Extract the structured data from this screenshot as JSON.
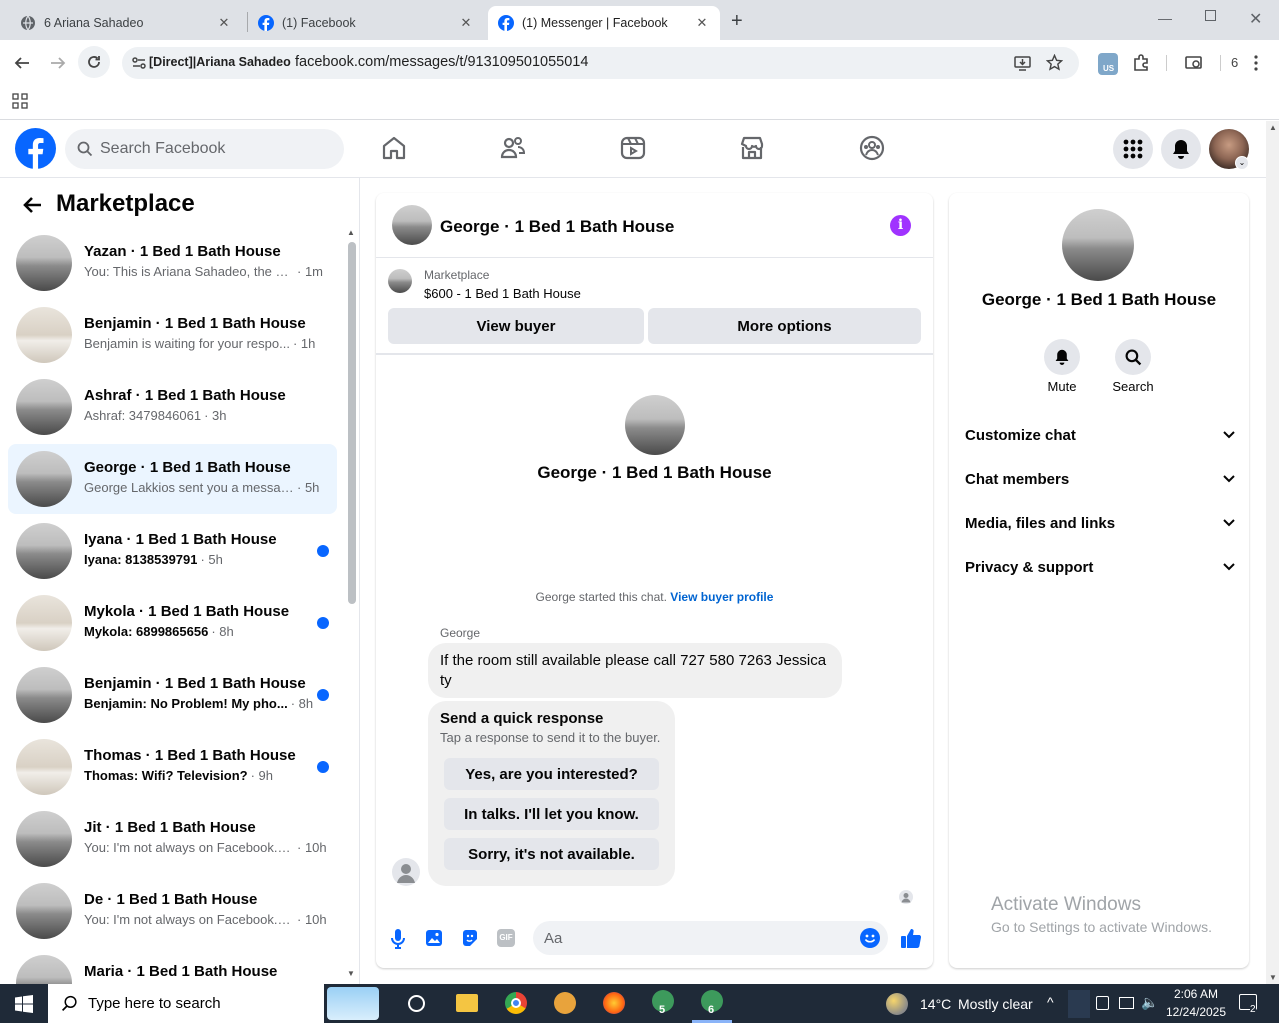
{
  "browser": {
    "tabs": [
      {
        "title": "6 Ariana Sahadeo"
      },
      {
        "title": "(1) Facebook"
      },
      {
        "title": "(1) Messenger | Facebook"
      }
    ],
    "site_chip": "[Direct]|Ariana Sahadeo",
    "url": "facebook.com/messages/t/913109501055014",
    "profile_count": "6"
  },
  "header": {
    "search_placeholder": "Search Facebook"
  },
  "sidebar": {
    "title": "Marketplace",
    "conversations": [
      {
        "name": "Yazan · 1 Bed 1 Bath House",
        "preview": "You: This is Ariana Sahadeo, the pr...",
        "time": "· 1m",
        "unread": false,
        "avatar": "house"
      },
      {
        "name": "Benjamin · 1 Bed 1 Bath House",
        "preview": "Benjamin is waiting for your respo...",
        "time": "· 1h",
        "unread": false,
        "avatar": "light"
      },
      {
        "name": "Ashraf · 1 Bed 1 Bath House",
        "preview": "Ashraf: 3479846061",
        "time": "· 3h",
        "unread": false,
        "avatar": "house"
      },
      {
        "name": "George · 1 Bed 1 Bath House",
        "preview": "George Lakkios sent you a messag...",
        "time": "· 5h",
        "unread": false,
        "avatar": "house"
      },
      {
        "name": "Iyana · 1 Bed 1 Bath House",
        "preview": "Iyana: 8138539791",
        "time": "· 5h",
        "unread": true,
        "avatar": "house"
      },
      {
        "name": "Mykola · 1 Bed 1 Bath House",
        "preview": "Mykola: 6899865656",
        "time": "· 8h",
        "unread": true,
        "avatar": "light"
      },
      {
        "name": "Benjamin · 1 Bed 1 Bath House",
        "preview": "Benjamin: No Problem! My pho...",
        "time": "· 8h",
        "unread": true,
        "avatar": "house"
      },
      {
        "name": "Thomas · 1 Bed 1 Bath House",
        "preview": "Thomas: Wifi? Television?",
        "time": "· 9h",
        "unread": true,
        "avatar": "light"
      },
      {
        "name": "Jit · 1 Bed 1 Bath House",
        "preview": "You: I'm not always on Facebook. I...",
        "time": "· 10h",
        "unread": false,
        "avatar": "house"
      },
      {
        "name": "De · 1 Bed 1 Bath House",
        "preview": "You: I'm not always on Facebook. I...",
        "time": "· 10h",
        "unread": false,
        "avatar": "house"
      },
      {
        "name": "Maria · 1 Bed 1 Bath House",
        "preview": "",
        "time": "",
        "unread": false,
        "avatar": "house"
      }
    ]
  },
  "chat": {
    "title": "George · 1 Bed 1 Bath House",
    "listing_source": "Marketplace",
    "listing": "$600 - 1 Bed 1 Bath House",
    "view_buyer": "View buyer",
    "more_options": "More options",
    "intro_name": "George · 1 Bed 1 Bath House",
    "started_text": "George started this chat.",
    "view_buyer_profile": "View buyer profile",
    "sender": "George",
    "message_line1": "If the room still available please call 727 580 7263 Jessica",
    "message_line2": "ty",
    "quick_title": "Send a quick response",
    "quick_sub": "Tap a response to send it to the buyer.",
    "quick_replies": [
      "Yes, are you interested?",
      "In talks. I'll let you know.",
      "Sorry, it's not available."
    ],
    "composer_placeholder": "Aa"
  },
  "right_panel": {
    "name": "George · 1 Bed 1 Bath House",
    "mute": "Mute",
    "search": "Search",
    "sections": [
      "Customize chat",
      "Chat members",
      "Media, files and links",
      "Privacy & support"
    ]
  },
  "watermark": {
    "line1": "Activate Windows",
    "line2": "Go to Settings to activate Windows."
  },
  "taskbar": {
    "search_placeholder": "Type here to search",
    "weather_temp": "14°C",
    "weather_text": "Mostly clear",
    "time": "2:06 AM",
    "date": "12/24/2025",
    "notif_count": "2",
    "badge_a": "5",
    "badge_b": "6"
  },
  "colors": {
    "accent": "#0866ff",
    "selected_row": "#ebf5ff",
    "info_purple": "#a033ff"
  }
}
